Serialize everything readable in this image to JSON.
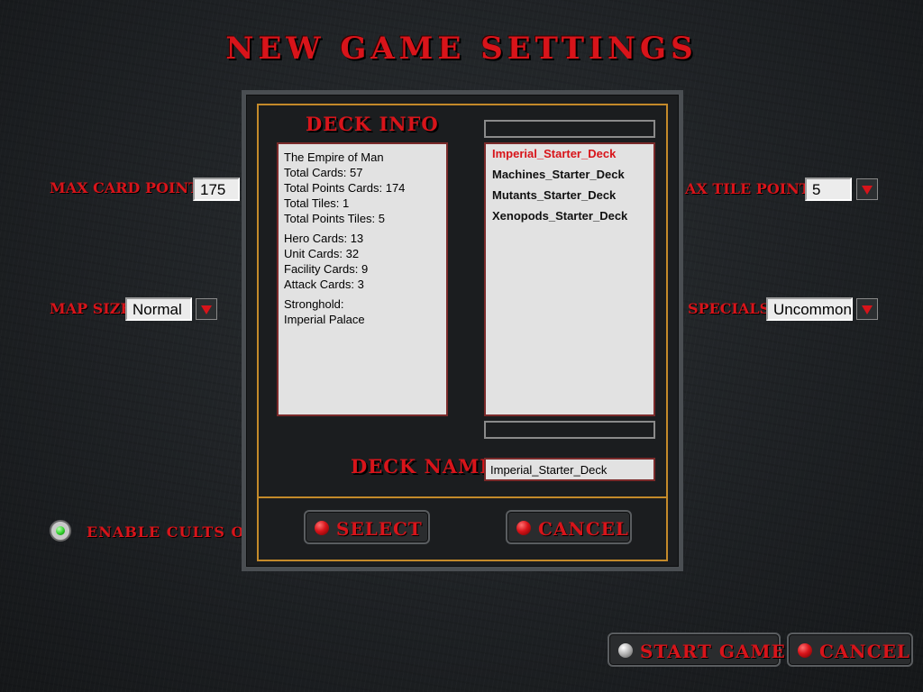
{
  "page": {
    "title": "NEW GAME SETTINGS"
  },
  "settings": {
    "max_card_points_label": "MAX CARD POINTS",
    "max_card_points_value": "175",
    "max_tile_points_label": "AX TILE POINTS",
    "max_tile_points_value": "5",
    "map_size_label": "MAP SIZE",
    "map_size_value": "Normal",
    "specials_label": "SPECIALS",
    "specials_value": "Uncommon",
    "cults_label": "ENABLE CULTS OF",
    "cults_enabled": true
  },
  "dialog": {
    "deck_info_title": "DECK INFO",
    "deck_info_lines": [
      "The Empire of Man",
      "Total Cards: 57",
      "Total Points Cards: 174",
      "Total Tiles: 1",
      "Total Points Tiles: 5",
      "Hero Cards: 13",
      "Unit Cards: 32",
      "Facility Cards: 9",
      "Attack Cards: 3",
      "Stronghold:",
      "Imperial Palace"
    ],
    "decks": [
      "Imperial_Starter_Deck",
      "Machines_Starter_Deck",
      "Mutants_Starter_Deck",
      "Xenopods_Starter_Deck"
    ],
    "selected_deck_index": 0,
    "deck_name_label": "DECK NAME:",
    "deck_name_value": "Imperial_Starter_Deck",
    "select_label": "SELECT",
    "cancel_label": "CANCEL"
  },
  "footer": {
    "start_game_label": "START GAME",
    "cancel_label": "CANCEL"
  },
  "colors": {
    "accent_red": "#d8141a",
    "frame_orange": "#c48a2a",
    "radio_green": "#2fd02a"
  }
}
